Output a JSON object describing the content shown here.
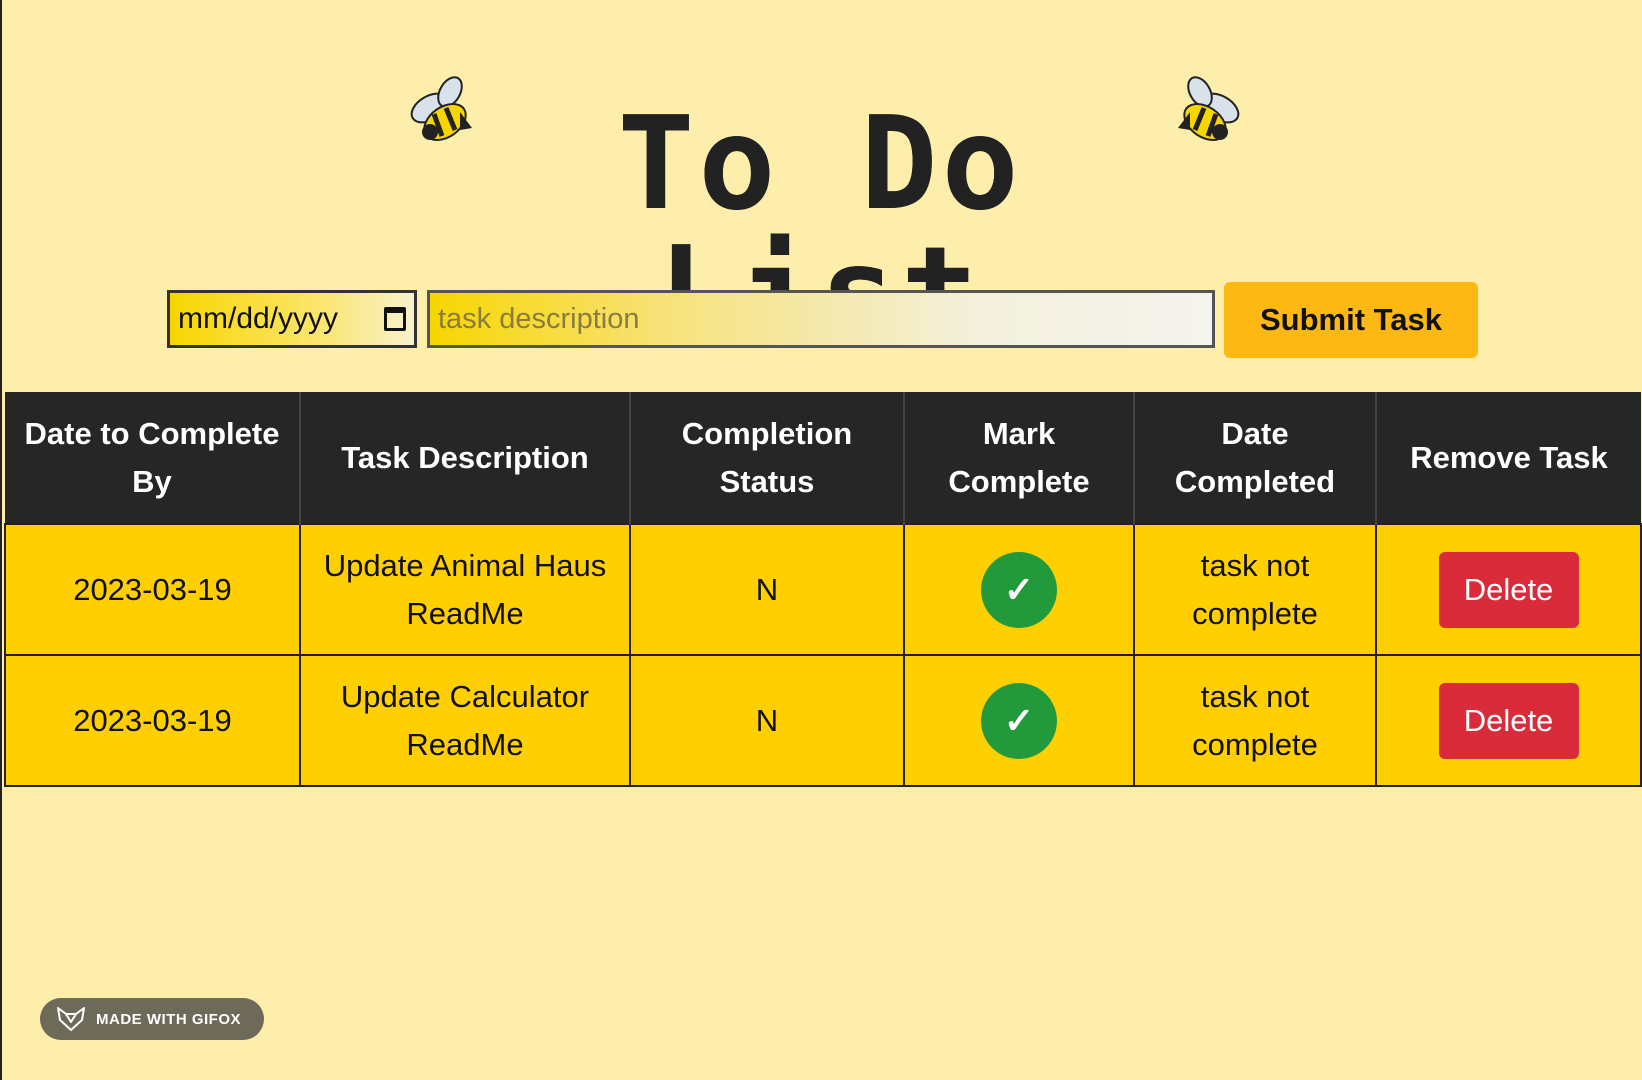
{
  "header": {
    "title": "To Do List",
    "left_icon": "bee-icon",
    "right_icon": "bee-icon"
  },
  "form": {
    "date_placeholder": "mm/dd/yyyy",
    "task_placeholder": "task description",
    "submit_label": "Submit Task"
  },
  "table": {
    "headers": [
      "Date to Complete By",
      "Task Description",
      "Completion Status",
      "Mark Complete",
      "Date Completed",
      "Remove Task"
    ],
    "rows": [
      {
        "date": "2023-03-19",
        "description": "Update Animal Haus ReadMe",
        "status": "N",
        "mark_icon": "✓",
        "date_completed": "task not complete",
        "delete_label": "Delete"
      },
      {
        "date": "2023-03-19",
        "description": "Update Calculator ReadMe",
        "status": "N",
        "mark_icon": "✓",
        "date_completed": "task not complete",
        "delete_label": "Delete"
      }
    ]
  },
  "badge": {
    "label": "MADE WITH GIFOX"
  },
  "colors": {
    "background": "#fdeeab",
    "header_bg": "#262626",
    "row_bg": "#ffcf00",
    "submit_bg": "#fdb813",
    "complete_green": "#229a3c",
    "delete_red": "#d92b3a"
  }
}
